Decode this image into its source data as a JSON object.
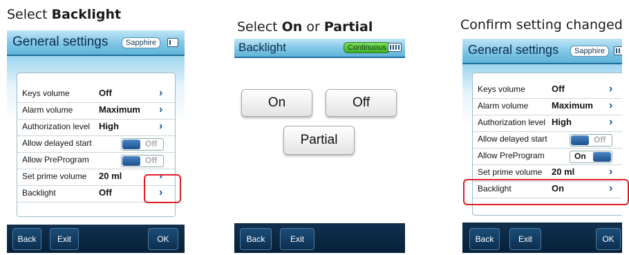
{
  "captions": {
    "step1_prefix": "Select ",
    "step1_bold": "Backlight",
    "step2_prefix": "Select ",
    "step2_on": "On",
    "step2_or": " or ",
    "step2_partial": "Partial",
    "step3": "Confirm setting changed"
  },
  "screen1": {
    "title": "General settings",
    "badge": "Sapphire",
    "rows": [
      {
        "label": "Keys volume",
        "value": "Off"
      },
      {
        "label": "Alarm volume",
        "value": "Maximum"
      },
      {
        "label": "Authorization level",
        "value": "High"
      },
      {
        "label": "Allow delayed start",
        "toggle": "Off"
      },
      {
        "label": "Allow PreProgram",
        "toggle": "Off"
      },
      {
        "label": "Set prime volume",
        "value": "20 ml"
      },
      {
        "label": "Backlight",
        "value": "Off"
      }
    ],
    "footer": {
      "back": "Back",
      "exit": "Exit",
      "ok": "OK"
    }
  },
  "screen2": {
    "title": "Backlight",
    "badge": "Continuous",
    "options": {
      "on": "On",
      "off": "Off",
      "partial": "Partial"
    },
    "footer": {
      "back": "Back",
      "exit": "Exit"
    }
  },
  "screen3": {
    "title": "General settings",
    "badge": "Sapphire",
    "rows": [
      {
        "label": "Keys volume",
        "value": "Off"
      },
      {
        "label": "Alarm volume",
        "value": "Maximum"
      },
      {
        "label": "Authorization level",
        "value": "High"
      },
      {
        "label": "Allow delayed start",
        "toggle": "Off"
      },
      {
        "label": "Allow PreProgram",
        "toggle": "On"
      },
      {
        "label": "Set prime volume",
        "value": "20 ml"
      },
      {
        "label": "Backlight",
        "value": "On"
      }
    ],
    "footer": {
      "back": "Back",
      "exit": "Exit",
      "ok": "OK"
    }
  },
  "colors": {
    "highlight": "#e01b24",
    "header": "#7fc6e6",
    "footer": "#0c2f4f",
    "chevron": "#1a4e8a"
  }
}
